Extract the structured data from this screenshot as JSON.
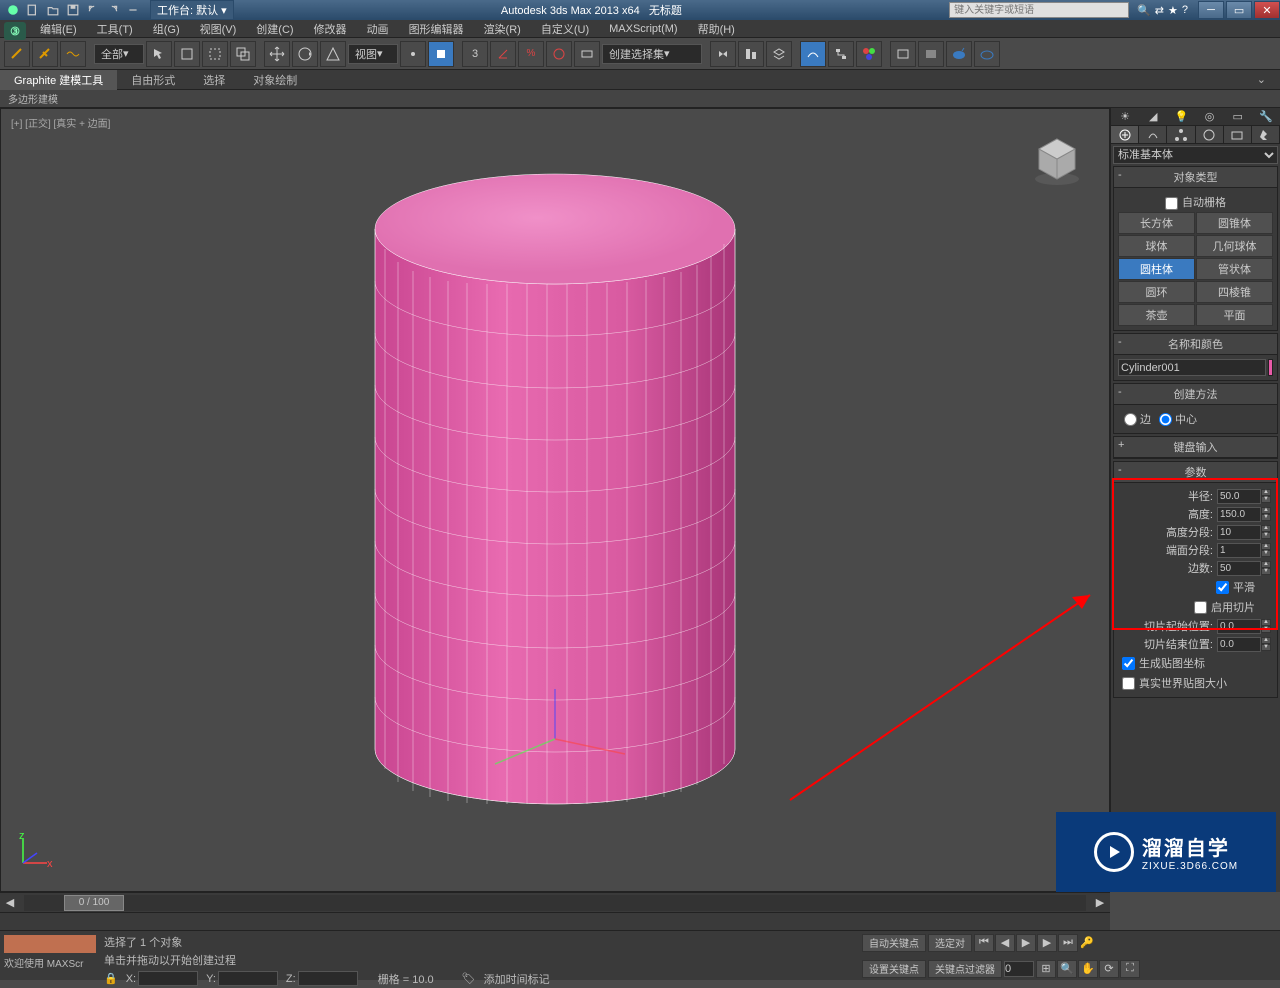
{
  "title": {
    "workspace_label": "工作台: 默认",
    "app": "Autodesk 3ds Max  2013 x64",
    "doc": "无标题",
    "search_placeholder": "键入关键字或短语"
  },
  "menu": [
    "编辑(E)",
    "工具(T)",
    "组(G)",
    "视图(V)",
    "创建(C)",
    "修改器",
    "动画",
    "图形编辑器",
    "渲染(R)",
    "自定义(U)",
    "MAXScript(M)",
    "帮助(H)"
  ],
  "maintb": {
    "filter": "全部",
    "refcoord": "视图",
    "named_sel": "创建选择集"
  },
  "ribbon_tabs": [
    "Graphite 建模工具",
    "自由形式",
    "选择",
    "对象绘制"
  ],
  "ribbon_sub": "多边形建模",
  "viewport": {
    "label": "[+] [正交] [真实 + 边面]"
  },
  "panel": {
    "category": "标准基本体",
    "rollouts": {
      "obj_type": "对象类型",
      "autogrid": "自动栅格",
      "name_color": "名称和颜色",
      "creation": "创建方法",
      "keyboard": "键盘输入",
      "params": "参数"
    },
    "primitives": [
      [
        "长方体",
        "圆锥体"
      ],
      [
        "球体",
        "几何球体"
      ],
      [
        "圆柱体",
        "管状体"
      ],
      [
        "圆环",
        "四棱锥"
      ],
      [
        "茶壶",
        "平面"
      ]
    ],
    "active_prim": "圆柱体",
    "object_name": "Cylinder001",
    "creation_edge": "边",
    "creation_center": "中心",
    "params": {
      "radius_lbl": "半径:",
      "radius": "50.0",
      "height_lbl": "高度:",
      "height": "150.0",
      "hseg_lbl": "高度分段:",
      "hseg": "10",
      "cseg_lbl": "端面分段:",
      "cseg": "1",
      "sides_lbl": "边数:",
      "sides": "50",
      "smooth": "平滑",
      "slice_on": "启用切片",
      "slice_from_lbl": "切片起始位置:",
      "slice_from": "0.0",
      "slice_to_lbl": "切片结束位置:",
      "slice_to": "0.0",
      "gen_uv": "生成贴图坐标",
      "real_world": "真实世界贴图大小"
    }
  },
  "timeline": {
    "slider": "0 / 100"
  },
  "status": {
    "selected": "选择了 1 个对象",
    "welcome": "欢迎使用  MAXScr",
    "prompt": "单击并拖动以开始创建过程",
    "grid": "栅格 = 10.0",
    "add_time_tag": "添加时间标记",
    "autokey": "自动关键点",
    "setkey": "设置关键点",
    "selected_filter": "选定对",
    "keyfilter": "关键点过滤器",
    "x": "X:",
    "y": "Y:",
    "z": "Z:"
  },
  "watermark": {
    "brand": "溜溜自学",
    "url": "ZIXUE.3D66.COM"
  }
}
